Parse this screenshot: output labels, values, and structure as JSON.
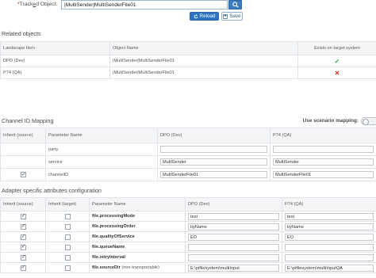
{
  "header": {
    "required_mark": "*",
    "tracked_label_before": "Track",
    "tracked_label_underlined": "e",
    "tracked_label_after": "d Object:",
    "object_value": "|MultiSender|MultiSenderFile01",
    "reload_label": "Reload",
    "save_label": "Save"
  },
  "related_objects": {
    "title": "Related objects",
    "columns": [
      "Landscape Item",
      "Object Name",
      "Exists on target system"
    ],
    "rows": [
      {
        "landscape_item": "DPO (Dev)",
        "object_name": "|MultiSender|MultiSenderFile01",
        "exists": "✓"
      },
      {
        "landscape_item": "P74 (QA)",
        "object_name": "|MultiSender|MultiSenderFile01",
        "exists": "✕"
      }
    ]
  },
  "channel_id_mapping": {
    "title": "Channel ID Mapping",
    "scenario_label": "Use scenario mapping:",
    "columns": [
      "Inherit (source)",
      "Parameter Name",
      "DPO (Dev)",
      "P74 (QA)"
    ],
    "rows": [
      {
        "inherit": false,
        "show_checkbox": false,
        "param": "party",
        "dev": "",
        "qa": ""
      },
      {
        "inherit": false,
        "show_checkbox": false,
        "param": "service",
        "dev": "MultiSender",
        "qa": "MultiSender"
      },
      {
        "inherit": true,
        "show_checkbox": true,
        "param": "channelID",
        "dev": "MultiSenderFile01",
        "qa": "MultiSenderFile01"
      }
    ]
  },
  "adapter_attributes": {
    "title": "Adapter specific attributes configuration",
    "columns": [
      "Inherit (source)",
      "Inherit (target)",
      "Parameter Name",
      "DPO (Dev)",
      "P74 (QA)"
    ],
    "rows": [
      {
        "inherit_source": true,
        "inherit_target": false,
        "param": "file.processingMode",
        "note": "",
        "dev": "test",
        "qa": "test"
      },
      {
        "inherit_source": true,
        "inherit_target": false,
        "param": "file.processingOrder",
        "note": "",
        "dev": "byName",
        "qa": "byName"
      },
      {
        "inherit_source": true,
        "inherit_target": false,
        "param": "file.qualityOfService",
        "note": "",
        "dev": "EO",
        "qa": "EO"
      },
      {
        "inherit_source": true,
        "inherit_target": false,
        "param": "file.queueName",
        "note": "",
        "dev": "",
        "qa": ""
      },
      {
        "inherit_source": true,
        "inherit_target": false,
        "param": "file.retryInterval",
        "note": "",
        "dev": "",
        "qa": ""
      },
      {
        "inherit_source": true,
        "inherit_target": false,
        "param": "file.sourceDir",
        "note": "(non-transportable)",
        "dev": "E:\\pifilesystem\\multiInput",
        "qa": "E:\\pifilesystem\\multiInputQA"
      }
    ]
  },
  "icons": [
    "search-icon",
    "reload-icon",
    "save-icon",
    "check-icon",
    "cross-icon"
  ],
  "colors": {
    "primary": "#2f74c0",
    "success": "#2b9f3c",
    "error": "#d8262d"
  }
}
